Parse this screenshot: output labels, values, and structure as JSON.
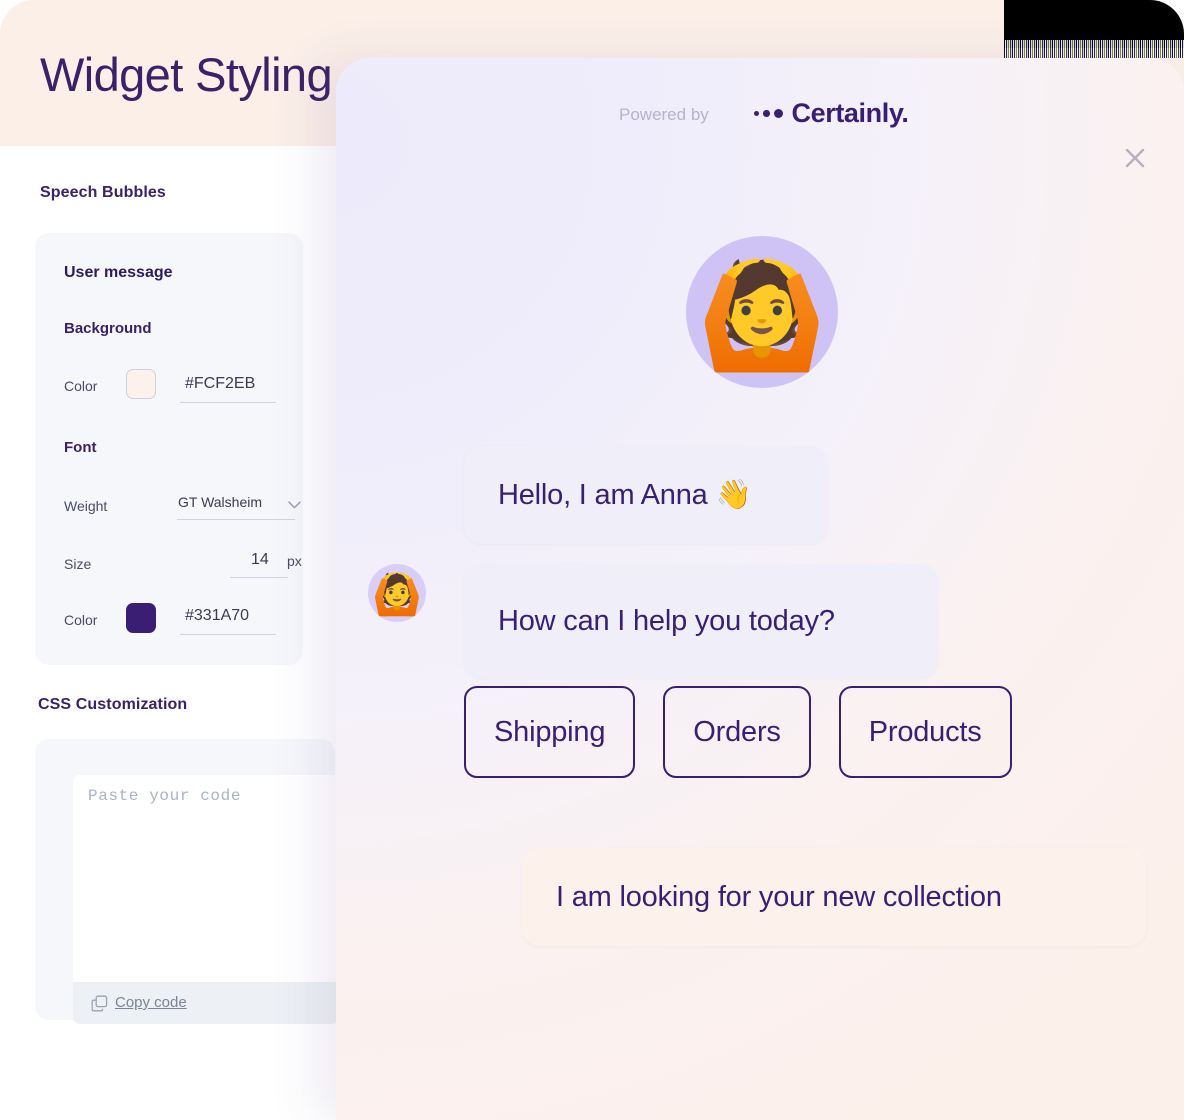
{
  "page": {
    "title": "Widget Styling",
    "sections": {
      "speech_bubbles_title": "Speech Bubbles",
      "css_customization_title": "CSS Customization"
    }
  },
  "speech_bubbles": {
    "card_heading": "User message",
    "background_group": {
      "label": "Background",
      "color_field_label": "Color",
      "color_value": "#FCF2EB",
      "swatch_color": "#FCF2EB"
    },
    "font_group": {
      "label": "Font",
      "weight_field_label": "Weight",
      "weight_value": "GT Walsheim",
      "size_field_label": "Size",
      "size_value": "14",
      "size_unit": "px",
      "color_field_label": "Color",
      "color_value": "#331A70",
      "swatch_color": "#331A70"
    }
  },
  "css_customization": {
    "code_placeholder": "Paste your code",
    "code_value": "",
    "copy_label": "Copy code"
  },
  "widget": {
    "header": {
      "powered_by": "Powered by",
      "brand": "Certainly."
    },
    "hero_avatar_emoji": "🙆",
    "inline_avatar_emoji": "🙆",
    "messages": [
      {
        "sender": "bot",
        "text": "Hello, I am Anna 👋"
      },
      {
        "sender": "bot",
        "text": "How can I help you today?"
      },
      {
        "sender": "user",
        "text": "I am looking for your new collection"
      }
    ],
    "quick_replies": [
      "Shipping",
      "Orders",
      "Products"
    ]
  }
}
